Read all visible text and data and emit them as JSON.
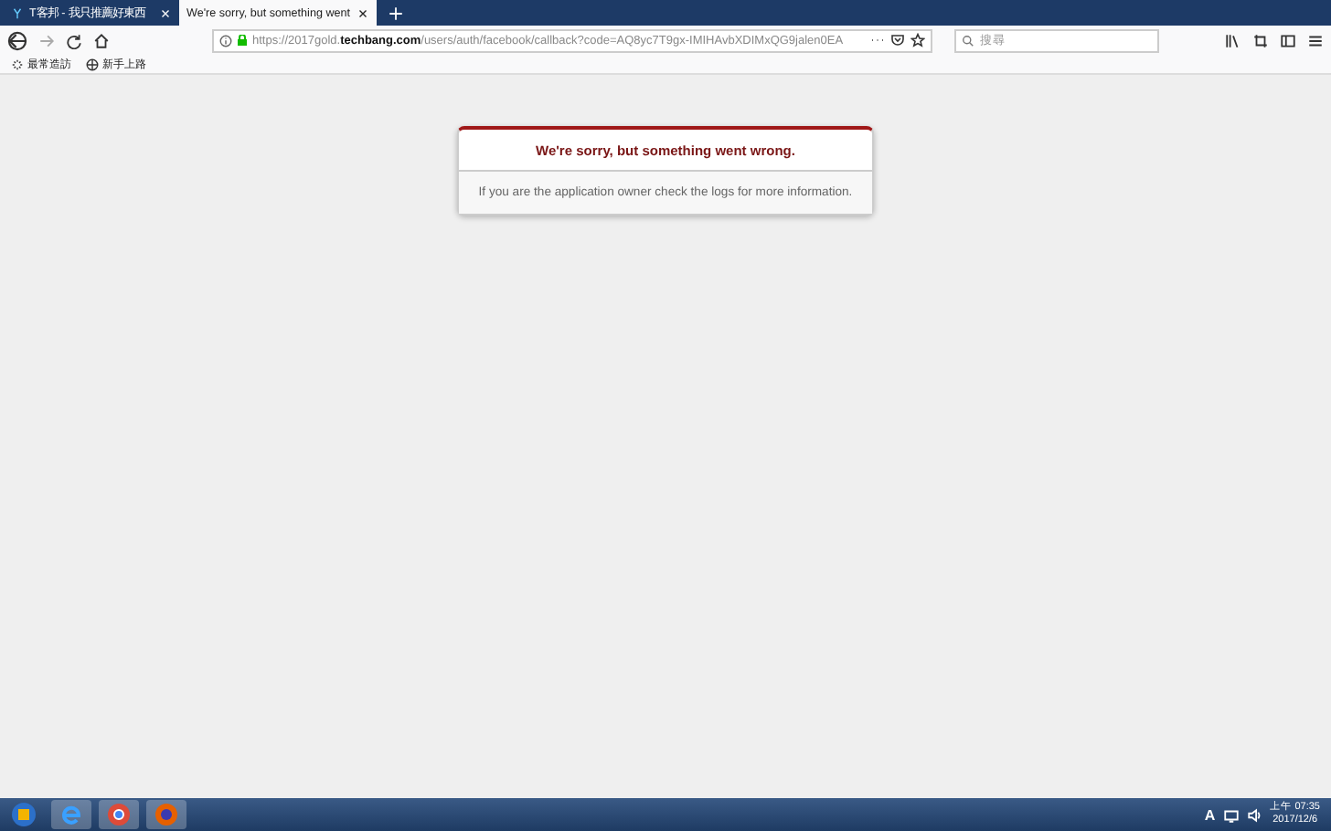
{
  "tabs": [
    {
      "title": "T客邦 - 我只推薦好東西",
      "selected": false
    },
    {
      "title": "We're sorry, but something went",
      "selected": true
    }
  ],
  "address": {
    "scheme_host": "https://2017gold.",
    "domain": "techbang.com",
    "path": "/users/auth/facebook/callback?code=AQ8yc7T9gx-IMIHAvbXDIMxQG9jalen0EA"
  },
  "search": {
    "placeholder": "搜尋"
  },
  "bookmarks": [
    "最常造訪",
    "新手上路"
  ],
  "error": {
    "title": "We're sorry, but something went wrong.",
    "message": "If you are the application owner check the logs for more information."
  },
  "tray": {
    "language": "A",
    "time": "上午 07:35",
    "date": "2017/12/6"
  }
}
